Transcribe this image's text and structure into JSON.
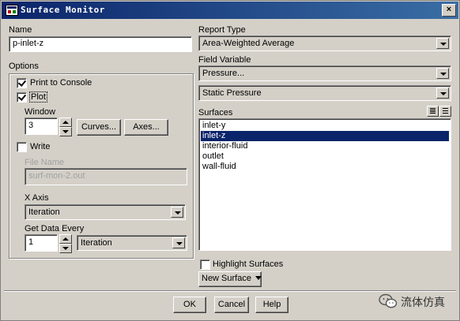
{
  "window": {
    "title": "Surface Monitor",
    "close_glyph": "×"
  },
  "name": {
    "label": "Name",
    "value": "p-inlet-z"
  },
  "options": {
    "label": "Options",
    "print_to_console": {
      "label": "Print to Console",
      "checked": true
    },
    "plot": {
      "label": "Plot",
      "checked": true
    },
    "window": {
      "label": "Window",
      "value": "3"
    },
    "curves_button": "Curves...",
    "axes_button": "Axes...",
    "write": {
      "label": "Write",
      "checked": false
    },
    "file_name": {
      "label": "File Name",
      "value": "surf-mon-2.out"
    },
    "x_axis": {
      "label": "X Axis",
      "value": "Iteration"
    },
    "get_data_every": {
      "label": "Get Data Every",
      "value": "1",
      "unit": "Iteration"
    }
  },
  "report_type": {
    "label": "Report Type",
    "value": "Area-Weighted Average"
  },
  "field_variable": {
    "label": "Field Variable",
    "category": "Pressure...",
    "value": "Static Pressure"
  },
  "surfaces": {
    "label": "Surfaces",
    "items": [
      "inlet-y",
      "inlet-z",
      "interior-fluid",
      "outlet",
      "wall-fluid"
    ],
    "selected": "inlet-z"
  },
  "highlight_surfaces": {
    "label": "Highlight Surfaces",
    "checked": false
  },
  "new_surface_button": "New Surface",
  "footer": {
    "ok": "OK",
    "cancel": "Cancel",
    "help": "Help"
  },
  "watermark": {
    "text": "流体仿真",
    "icon": "wechat-icon"
  },
  "colors": {
    "title_bar": "#0a246a",
    "selection": "#0a246a",
    "dialog_bg": "#d4d0c8"
  }
}
